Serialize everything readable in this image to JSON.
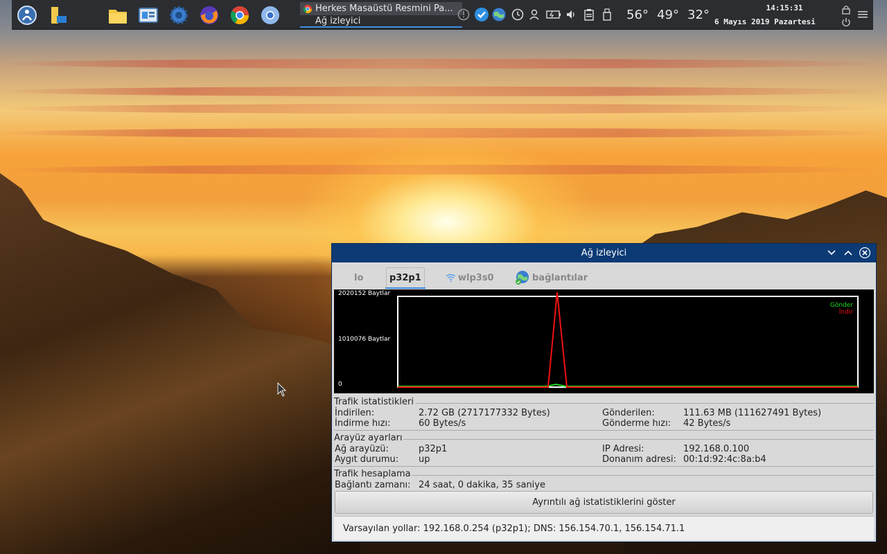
{
  "taskbar": {
    "task_title": "Herkes Masaüstü Resmini Pa...",
    "task_subtitle": "Ağ izleyici",
    "temps": [
      "56°",
      "49°",
      "32°"
    ],
    "clock_time": "14:15:31",
    "clock_date": "6 Mayıs 2019 Pazartesi"
  },
  "window": {
    "title": "Ağ izleyici",
    "tabs": [
      {
        "label": "lo"
      },
      {
        "label": "p32p1"
      },
      {
        "label": "wlp3s0"
      },
      {
        "label": "bağlantılar"
      }
    ],
    "active_tab": "p32p1",
    "graph": {
      "y_labels": [
        "2020152 Baytlar",
        "1010076 Baytlar",
        "0"
      ],
      "legend_send": "Gönder",
      "legend_recv": "İndir"
    },
    "traffic": {
      "title": "Trafik istatistikleri",
      "downloaded_label": "İndirilen:",
      "downloaded_value": "2.72 GB (2717177332 Bytes)",
      "down_speed_label": "İndirme hızı:",
      "down_speed_value": "60 Bytes/s",
      "sent_label": "Gönderilen:",
      "sent_value": "111.63 MB (111627491 Bytes)",
      "up_speed_label": "Gönderme hızı:",
      "up_speed_value": "42 Bytes/s"
    },
    "iface": {
      "title": "Arayüz ayarları",
      "iface_label": "Ağ arayüzü:",
      "iface_value": "p32p1",
      "state_label": "Aygıt durumu:",
      "state_value": "up",
      "ip_label": "IP Adresi:",
      "ip_value": "192.168.0.100",
      "hw_label": "Donanım adresi:",
      "hw_value": "00:1d:92:4c:8a:b4"
    },
    "accounting": {
      "title": "Trafik hesaplama",
      "conn_label": "Bağlantı zamanı:",
      "conn_value": "24 saat, 0 dakika, 35 saniye"
    },
    "details_button": "Ayrıntılı ağ istatistiklerini göster",
    "footer": "Varsayılan yollar: 192.168.0.254 (p32p1); DNS: 156.154.70.1, 156.154.71.1"
  },
  "colors": {
    "send": "#22dd22",
    "recv": "#ee1111",
    "titlebar": "#0c3a75",
    "accent": "#3d8ee0"
  }
}
